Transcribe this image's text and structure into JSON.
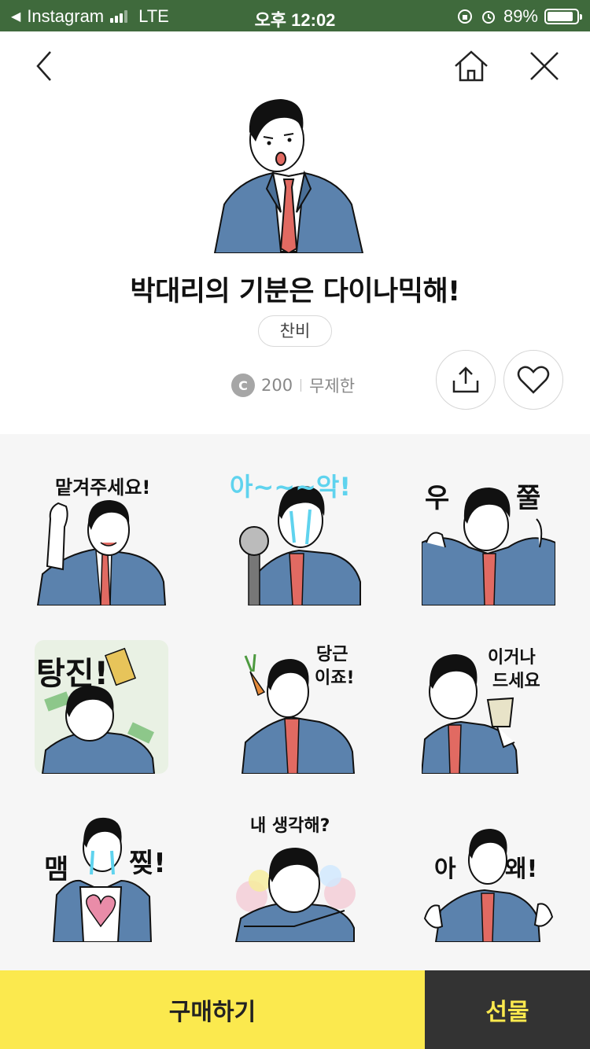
{
  "status_bar": {
    "back_app": "Instagram",
    "network": "LTE",
    "time": "오후 12:02",
    "battery_percent": "89%",
    "battery_level": 0.89
  },
  "header": {
    "back_icon": "chevron-left-icon",
    "home_icon": "home-icon",
    "close_icon": "close-icon"
  },
  "pack": {
    "title": "박대리의 기분은 다이나믹해!",
    "author": "찬비",
    "price": "200",
    "coin_symbol": "C",
    "duration": "무제한"
  },
  "actions": {
    "share_icon": "share-icon",
    "like_icon": "heart-icon"
  },
  "stickers": [
    {
      "caption": "맡겨주세요!"
    },
    {
      "caption": "아~~~악!"
    },
    {
      "caption_left": "우",
      "caption_right": "쭐"
    },
    {
      "caption": "탕진!"
    },
    {
      "caption_line1": "당근",
      "caption_line2": "이죠!"
    },
    {
      "caption_line1": "이거나",
      "caption_line2": "드세요"
    },
    {
      "caption_left": "맴",
      "caption_right": "찢!"
    },
    {
      "caption": "내 생각해?"
    },
    {
      "caption_left": "아",
      "caption_right": "왜!"
    }
  ],
  "footer": {
    "buy_label": "구매하기",
    "gift_label": "선물"
  },
  "colors": {
    "status_bar_bg": "#3f6a3c",
    "buy_bg": "#fbe94e",
    "gift_bg": "#333333",
    "gift_text": "#fbe94e",
    "suit": "#5b82ad",
    "tie": "#e16a62"
  }
}
